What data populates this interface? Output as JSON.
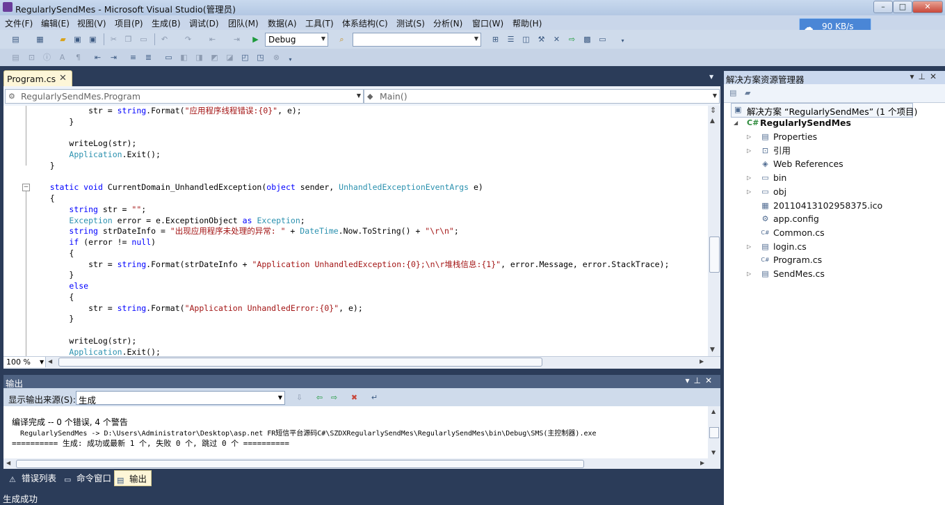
{
  "window": {
    "title": "RegularlySendMes - Microsoft Visual Studio(管理员)",
    "minimize": "–",
    "restore": "□",
    "close": "✕"
  },
  "menu": [
    "文件(F)",
    "编辑(E)",
    "视图(V)",
    "项目(P)",
    "生成(B)",
    "调试(D)",
    "团队(M)",
    "数据(A)",
    "工具(T)",
    "体系结构(C)",
    "测试(S)",
    "分析(N)",
    "窗口(W)",
    "帮助(H)"
  ],
  "network": {
    "speed": "90 KB/s"
  },
  "toolbar": {
    "config_value": "Debug",
    "find_value": ""
  },
  "editor": {
    "tab_label": "Program.cs",
    "tab_close": "✕",
    "type_selector": "RegularlySendMes.Program",
    "member_selector": "Main()",
    "zoom": "100 %"
  },
  "code_lines": [
    [
      {
        "t": "            str = "
      },
      {
        "t": "string",
        "c": "kw"
      },
      {
        "t": ".Format("
      },
      {
        "t": "\"应用程序线程错误:{0}\"",
        "c": "st"
      },
      {
        "t": ", e);"
      }
    ],
    [
      {
        "t": "        }"
      }
    ],
    [
      {
        "t": ""
      }
    ],
    [
      {
        "t": "        writeLog(str);"
      }
    ],
    [
      {
        "t": "        "
      },
      {
        "t": "Application",
        "c": "ty"
      },
      {
        "t": ".Exit();"
      }
    ],
    [
      {
        "t": "    }"
      }
    ],
    [
      {
        "t": ""
      }
    ],
    [
      {
        "t": "    "
      },
      {
        "t": "static void",
        "c": "kw"
      },
      {
        "t": " CurrentDomain_UnhandledException("
      },
      {
        "t": "object",
        "c": "kw"
      },
      {
        "t": " sender, "
      },
      {
        "t": "UnhandledExceptionEventArgs",
        "c": "ty"
      },
      {
        "t": " e)"
      }
    ],
    [
      {
        "t": "    {"
      }
    ],
    [
      {
        "t": "        "
      },
      {
        "t": "string",
        "c": "kw"
      },
      {
        "t": " str = "
      },
      {
        "t": "\"\"",
        "c": "st"
      },
      {
        "t": ";"
      }
    ],
    [
      {
        "t": "        "
      },
      {
        "t": "Exception",
        "c": "ty"
      },
      {
        "t": " error = e.ExceptionObject "
      },
      {
        "t": "as",
        "c": "kw"
      },
      {
        "t": " "
      },
      {
        "t": "Exception",
        "c": "ty"
      },
      {
        "t": ";"
      }
    ],
    [
      {
        "t": "        "
      },
      {
        "t": "string",
        "c": "kw"
      },
      {
        "t": " strDateInfo = "
      },
      {
        "t": "\"出现应用程序未处理的异常: \"",
        "c": "st"
      },
      {
        "t": " + "
      },
      {
        "t": "DateTime",
        "c": "ty"
      },
      {
        "t": ".Now.ToString() + "
      },
      {
        "t": "\"\\r\\n\"",
        "c": "st"
      },
      {
        "t": ";"
      }
    ],
    [
      {
        "t": "        "
      },
      {
        "t": "if",
        "c": "kw"
      },
      {
        "t": " (error != "
      },
      {
        "t": "null",
        "c": "kw"
      },
      {
        "t": ")"
      }
    ],
    [
      {
        "t": "        {"
      }
    ],
    [
      {
        "t": "            str = "
      },
      {
        "t": "string",
        "c": "kw"
      },
      {
        "t": ".Format(strDateInfo + "
      },
      {
        "t": "\"Application UnhandledException:{0};\\n\\r堆栈信息:{1}\"",
        "c": "st"
      },
      {
        "t": ", error.Message, error.StackTrace);"
      }
    ],
    [
      {
        "t": "        }"
      }
    ],
    [
      {
        "t": "        "
      },
      {
        "t": "else",
        "c": "kw"
      }
    ],
    [
      {
        "t": "        {"
      }
    ],
    [
      {
        "t": "            str = "
      },
      {
        "t": "string",
        "c": "kw"
      },
      {
        "t": ".Format("
      },
      {
        "t": "\"Application UnhandledError:{0}\"",
        "c": "st"
      },
      {
        "t": ", e);"
      }
    ],
    [
      {
        "t": "        }"
      }
    ],
    [
      {
        "t": ""
      }
    ],
    [
      {
        "t": "        writeLog(str);"
      }
    ],
    [
      {
        "t": "        "
      },
      {
        "t": "Application",
        "c": "ty"
      },
      {
        "t": ".Exit();"
      }
    ]
  ],
  "output": {
    "title": "输出",
    "source_label": "显示输出来源(S):",
    "source_value": "生成",
    "lines": [
      "编译完成 -- 0 个错误, 4 个警告",
      "  RegularlySendMes -> D:\\Users\\Administrator\\Desktop\\asp.net FR短信平台源码C#\\SZDXRegularlySendMes\\RegularlySendMes\\bin\\Debug\\SMS(主控制器).exe",
      "========== 生成: 成功或最新 1 个, 失败 0 个, 跳过 0 个 =========="
    ]
  },
  "bottom_tabs": [
    "错误列表",
    "命令窗口",
    "输出"
  ],
  "status": "生成成功",
  "solution_explorer": {
    "title": "解决方案资源管理器",
    "solution": "解决方案 “RegularlySendMes” (1 个项目)",
    "project": "RegularlySendMes",
    "items": [
      {
        "label": "Properties",
        "expandable": true,
        "icon": "properties-icon"
      },
      {
        "label": "引用",
        "expandable": true,
        "icon": "references-icon"
      },
      {
        "label": "Web References",
        "expandable": false,
        "icon": "web-references-icon"
      },
      {
        "label": "bin",
        "expandable": true,
        "icon": "folder-icon"
      },
      {
        "label": "obj",
        "expandable": true,
        "icon": "folder-icon"
      },
      {
        "label": "20110413102958375.ico",
        "expandable": false,
        "icon": "ico-file-icon"
      },
      {
        "label": "app.config",
        "expandable": false,
        "icon": "config-file-icon"
      },
      {
        "label": "Common.cs",
        "expandable": false,
        "icon": "cs-file-icon"
      },
      {
        "label": "login.cs",
        "expandable": true,
        "icon": "cs-form-icon"
      },
      {
        "label": "Program.cs",
        "expandable": false,
        "icon": "cs-file-icon"
      },
      {
        "label": "SendMes.cs",
        "expandable": true,
        "icon": "cs-form-icon"
      }
    ]
  },
  "colors": {
    "frame": "#2b3c59",
    "keyword": "#0000ff",
    "type": "#2b91af",
    "string": "#a31515",
    "active_tab": "#fdf6d8"
  }
}
